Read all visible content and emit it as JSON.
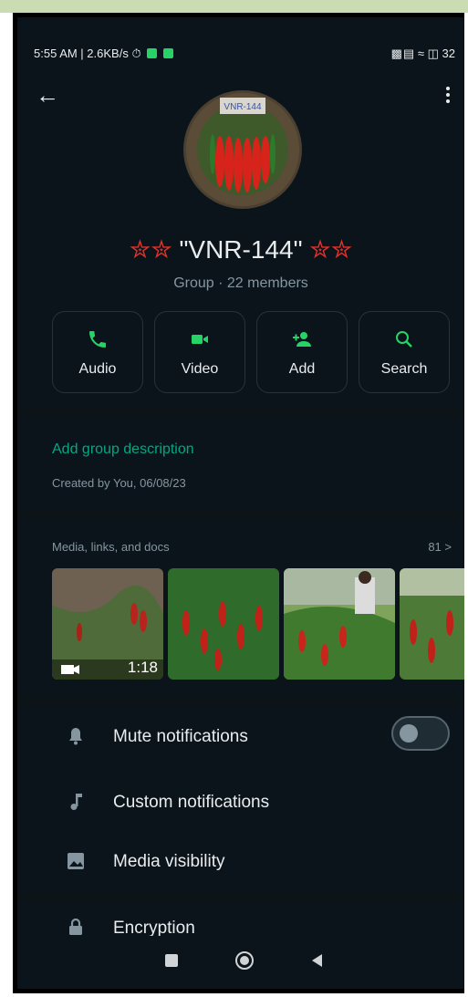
{
  "status_bar": {
    "left_text": "5:55 AM | 2.6KB/s",
    "right_text": "32"
  },
  "group": {
    "name": "\"VNR-144\"",
    "subtitle": "Group · 22 members",
    "avatar_label": "VNR-144"
  },
  "actions": [
    {
      "label": "Audio",
      "icon": "phone-icon"
    },
    {
      "label": "Video",
      "icon": "video-icon"
    },
    {
      "label": "Add",
      "icon": "add-person-icon"
    },
    {
      "label": "Search",
      "icon": "search-icon"
    }
  ],
  "description": {
    "add_label": "Add group description",
    "created": "Created by You, 06/08/23"
  },
  "media": {
    "header": "Media, links, and docs",
    "count": "81 >",
    "video_duration": "1:18"
  },
  "settings": [
    {
      "label": "Mute notifications",
      "icon": "bell-icon",
      "toggle": false
    },
    {
      "label": "Custom notifications",
      "icon": "music-note-icon"
    },
    {
      "label": "Media visibility",
      "icon": "image-icon"
    },
    {
      "label": "Encryption",
      "icon": "lock-icon"
    }
  ],
  "colors": {
    "accent": "#25d366",
    "link": "#00a884",
    "background": "#0b141a"
  }
}
